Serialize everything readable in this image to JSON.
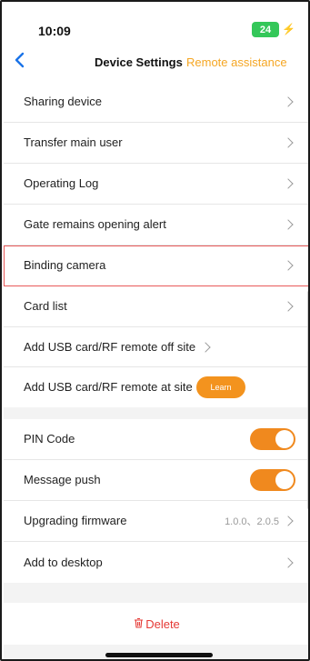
{
  "status_bar": {
    "time": "10:09",
    "battery": "24",
    "charging_icon": "bolt-icon"
  },
  "nav": {
    "back_icon": "chevron-left-icon",
    "title": "Device Settings",
    "action": "Remote assistance"
  },
  "group1": {
    "items": [
      {
        "label": "Sharing device"
      },
      {
        "label": "Transfer main user"
      },
      {
        "label": "Operating Log"
      },
      {
        "label": "Gate remains opening alert"
      },
      {
        "label": "Binding camera"
      },
      {
        "label": "Card list"
      },
      {
        "label": "Add USB card/RF remote off site"
      },
      {
        "label": "Add USB card/RF remote at site",
        "button": "Learn"
      }
    ]
  },
  "group2": {
    "items": [
      {
        "label": "PIN Code",
        "toggle_on": true
      },
      {
        "label": "Message push",
        "toggle_on": true
      },
      {
        "label": "Upgrading firmware",
        "value": "1.0.0、2.0.5"
      },
      {
        "label": "Add to desktop"
      }
    ]
  },
  "delete": {
    "label": "Delete",
    "icon": "trash-icon"
  },
  "colors": {
    "accent": "#f5a623",
    "toggle": "#f0891e",
    "danger": "#e53935",
    "battery": "#34c759"
  }
}
